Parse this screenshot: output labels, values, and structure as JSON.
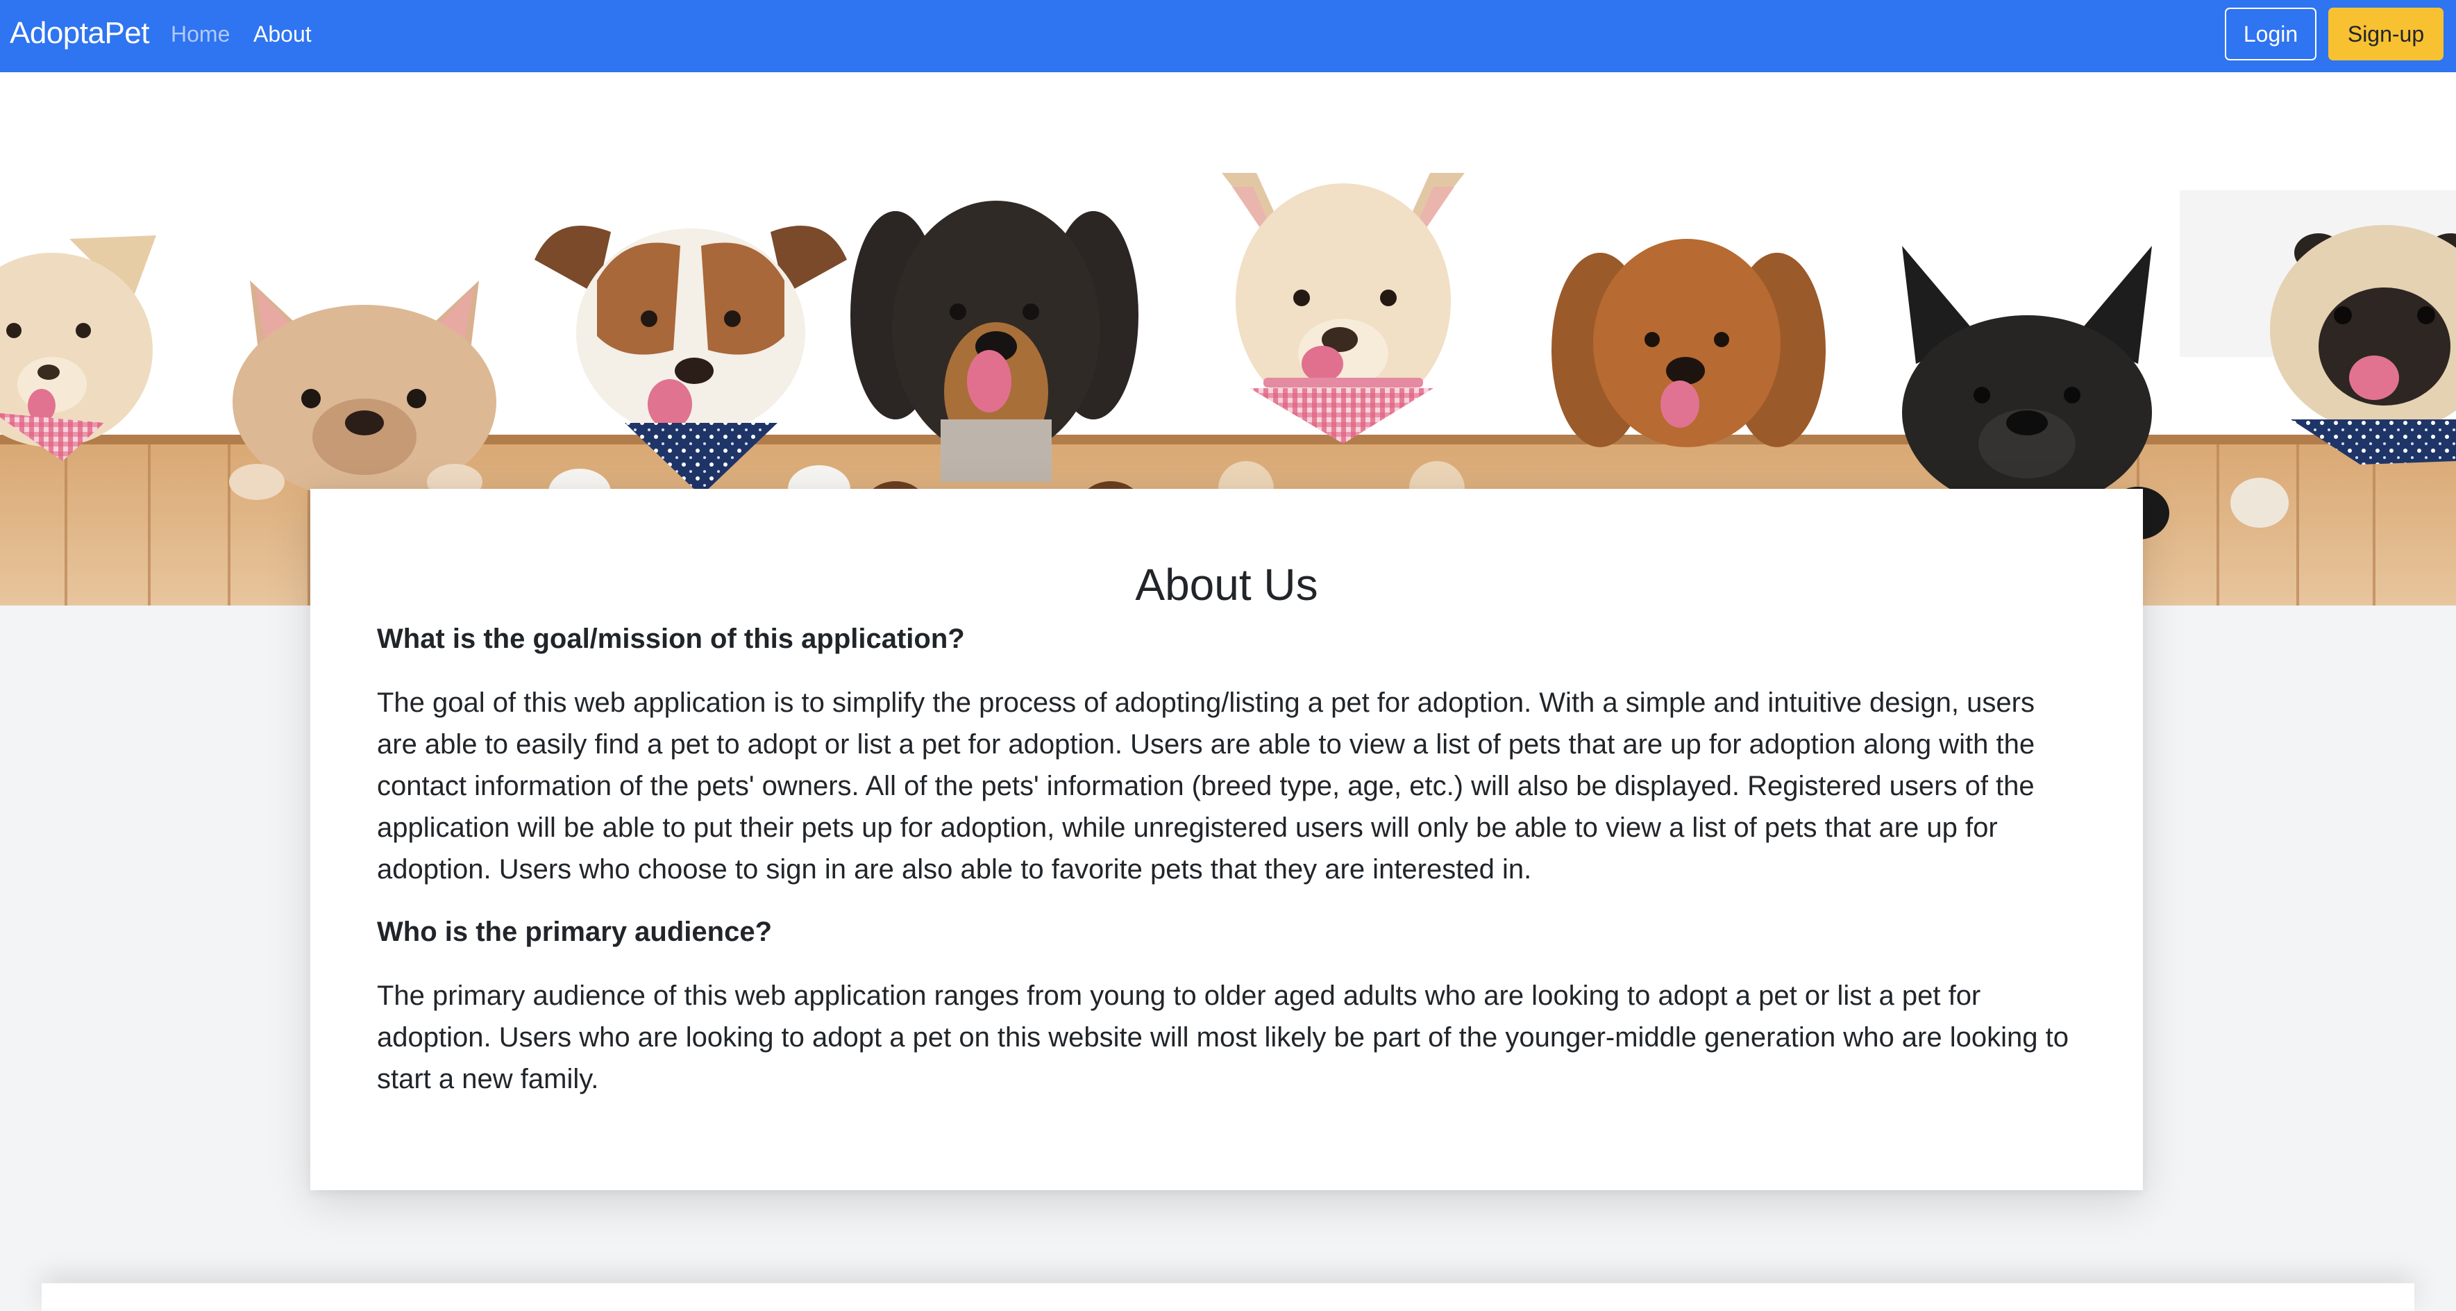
{
  "navbar": {
    "brand": "AdoptaPet",
    "links": [
      {
        "label": "Home",
        "active": false
      },
      {
        "label": "About",
        "active": true
      }
    ],
    "login_label": "Login",
    "signup_label": "Sign-up",
    "colors": {
      "background": "#2f74f0",
      "signup": "#f7c132"
    }
  },
  "hero": {
    "image": "row of dogs peeking over a wooden fence"
  },
  "about": {
    "title": "About Us",
    "sections": [
      {
        "question": "What is the goal/mission of this application?",
        "answer": "The goal of this web application is to simplify the process of adopting/listing a pet for adoption. With a simple and intuitive design, users are able to easily find a pet to adopt or list a pet for adoption. Users are able to view a list of pets that are up for adoption along with the contact information of the pets' owners. All of the pets' information (breed type, age, etc.) will also be displayed. Registered users of the application will be able to put their pets up for adoption, while unregistered users will only be able to view a list of pets that are up for adoption. Users who choose to sign in are also able to favorite pets that they are interested in."
      },
      {
        "question": "Who is the primary audience?",
        "answer": "The primary audience of this web application ranges from young to older aged adults who are looking to adopt a pet or list a pet for adoption. Users who are looking to adopt a pet on this website will most likely be part of the younger-middle generation who are looking to start a new family."
      }
    ]
  }
}
